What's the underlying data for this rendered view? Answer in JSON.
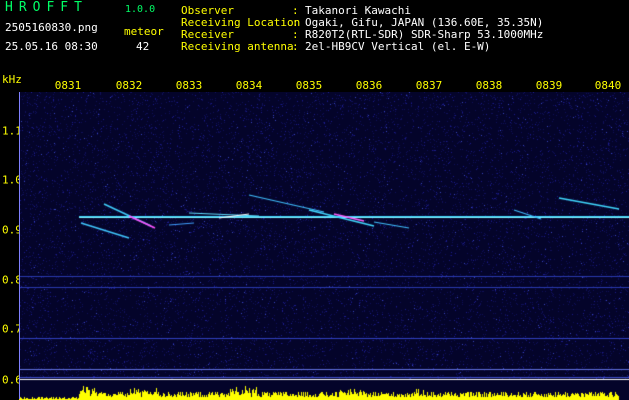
{
  "header": {
    "logo": "HROFFT",
    "version": "1.0.0",
    "filename": "2505160830.png",
    "datetime": "25.05.16 08:30",
    "meteor_label": "meteor",
    "meteor_count": "42"
  },
  "info": [
    {
      "label": "Observer",
      "sep": ":",
      "value": "Takanori Kawachi"
    },
    {
      "label": "Receiving Location",
      "sep": ":",
      "value": "Ogaki, Gifu, JAPAN (136.60E, 35.35N)"
    },
    {
      "label": "Receiver",
      "sep": ":",
      "value": "R820T2(RTL-SDR) SDR-Sharp 53.1000MHz"
    },
    {
      "label": "Receiving antenna",
      "sep": ":",
      "value": "2el-HB9CV Vertical (el. E-W)"
    }
  ],
  "axes": {
    "y_unit": "kHz",
    "y_ticks": [
      "1.1",
      "1.0",
      "0.9",
      "0.8",
      "0.7",
      "0.6"
    ],
    "x_ticks": [
      "0831",
      "0832",
      "0833",
      "0834",
      "0835",
      "0836",
      "0837",
      "0838",
      "0839",
      "0840"
    ]
  },
  "colors": {
    "text": "#ffff00",
    "logo": "#00ff66",
    "background_noise": "#0a0a60",
    "signal": "#40e0ff",
    "meteor_head": "#ff40ff",
    "spectrum_bar": "#ffff00"
  }
}
